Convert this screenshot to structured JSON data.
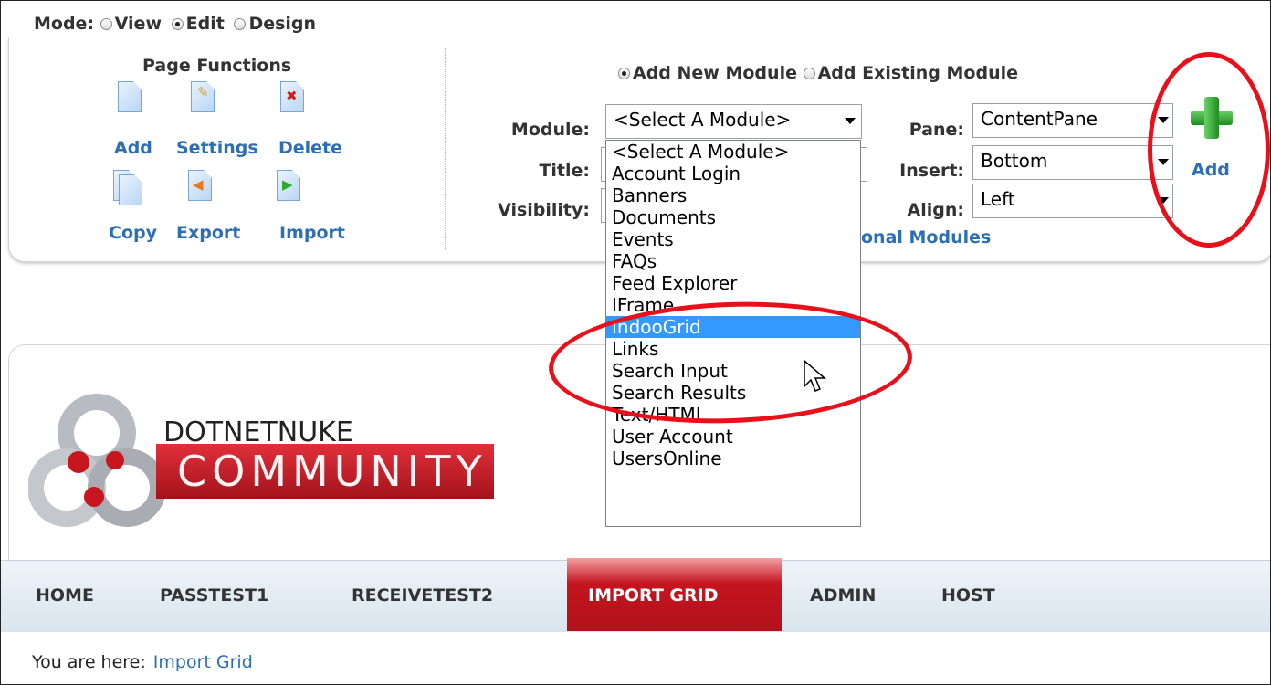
{
  "mode": {
    "label": "Mode:",
    "options": [
      "View",
      "Edit",
      "Design"
    ],
    "selected": "Edit"
  },
  "page_functions": {
    "title": "Page Functions",
    "items": [
      {
        "label": "Add",
        "icon": "page-add-icon"
      },
      {
        "label": "Settings",
        "icon": "page-settings-icon"
      },
      {
        "label": "Delete",
        "icon": "page-delete-icon"
      },
      {
        "label": "Copy",
        "icon": "page-copy-icon"
      },
      {
        "label": "Export",
        "icon": "page-export-icon"
      },
      {
        "label": "Import",
        "icon": "page-import-icon"
      }
    ]
  },
  "add_module": {
    "radio_new": "Add New Module",
    "radio_existing": "Add Existing Module",
    "selected": "Add New Module",
    "module_label": "Module:",
    "module_value": "<Select A Module>",
    "title_label": "Title:",
    "visibility_label": "Visibility:",
    "pane_label": "Pane:",
    "pane_value": "ContentPane",
    "insert_label": "Insert:",
    "insert_value": "Bottom",
    "align_label": "Align:",
    "align_value": "Left",
    "add_label": "Add",
    "additional_link": "onal Modules",
    "module_options": [
      "<Select A Module>",
      "Account Login",
      "Banners",
      "Documents",
      "Events",
      "FAQs",
      "Feed Explorer",
      "IFrame",
      "IndooGrid",
      "Links",
      "Search Input",
      "Search Results",
      "Text/HTML",
      "User Account",
      "UsersOnline"
    ],
    "highlighted_option": "IndooGrid"
  },
  "logo": {
    "line1": "DOTNETNUKE",
    "line2": "COMMUNITY"
  },
  "nav": {
    "items": [
      "HOME",
      "PASSTEST1",
      "RECEIVETEST2",
      "IMPORT GRID",
      "ADMIN",
      "HOST"
    ],
    "active": "IMPORT GRID"
  },
  "breadcrumb": {
    "label": "You are here:",
    "current": "Import Grid"
  },
  "colors": {
    "accent_red": "#e8101a",
    "link_blue": "#2e6fb3",
    "nav_active": "#c4141f",
    "highlight": "#3399ff"
  }
}
